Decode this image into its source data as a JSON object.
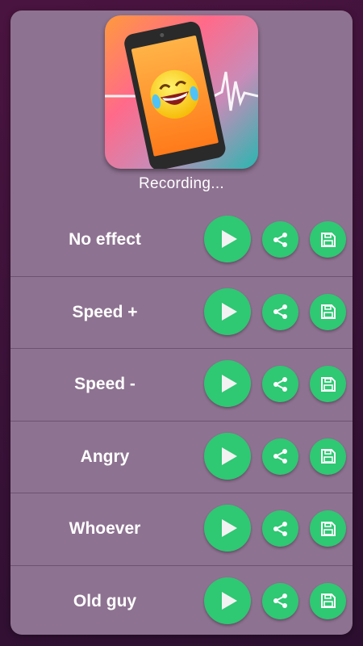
{
  "app": {
    "status_text": "Recording...",
    "accent_color": "#2fc873",
    "card_color": "#8e7291",
    "logo_icon": "laughing-phone-logo"
  },
  "effects": [
    {
      "label": "No effect"
    },
    {
      "label": "Speed +"
    },
    {
      "label": "Speed -"
    },
    {
      "label": "Angry"
    },
    {
      "label": "Whoever"
    },
    {
      "label": "Old guy"
    }
  ],
  "icons": {
    "play": "play-icon",
    "share": "share-icon",
    "save": "save-icon"
  }
}
